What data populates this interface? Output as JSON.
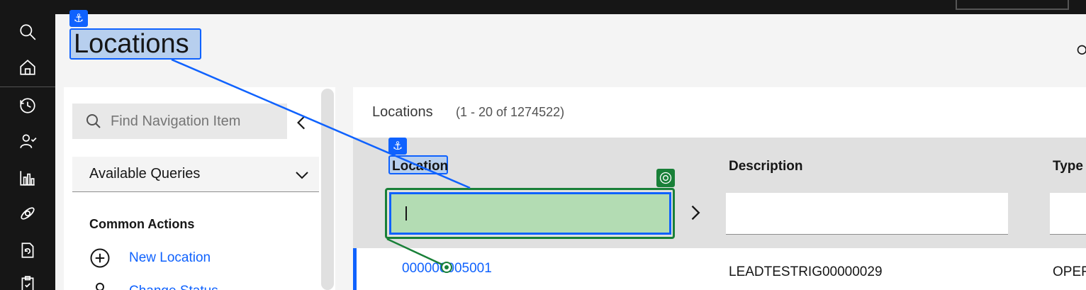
{
  "app": {
    "page_title": "Locations"
  },
  "rail": {
    "items": [
      {
        "name": "search-icon"
      },
      {
        "name": "home-icon"
      },
      {
        "name": "history-icon"
      },
      {
        "name": "user-check-icon"
      },
      {
        "name": "chart-icon"
      },
      {
        "name": "satellite-icon"
      },
      {
        "name": "sync-document-icon"
      },
      {
        "name": "clipboard-icon"
      }
    ]
  },
  "sidebar": {
    "search_placeholder": "Find Navigation Item",
    "queries_label": "Available Queries",
    "common_actions_heading": "Common Actions",
    "actions": [
      {
        "label": "New Location",
        "icon": "add-circle-icon"
      },
      {
        "label": "Change Status",
        "icon": "person-icon"
      }
    ]
  },
  "main": {
    "title": "Locations",
    "count": "(1 - 20 of 1274522)",
    "columns": [
      "Location",
      "Description",
      "Type"
    ],
    "rows": [
      {
        "location": "000000005001",
        "description": "LEADTESTRIG00000029",
        "type": "OPER"
      }
    ]
  },
  "colors": {
    "accent": "#0f62fe",
    "rail_bg": "#161616",
    "focus_green": "#198038",
    "highlight_blue": "#b7cfee",
    "highlight_green": "#b3dcb3"
  }
}
